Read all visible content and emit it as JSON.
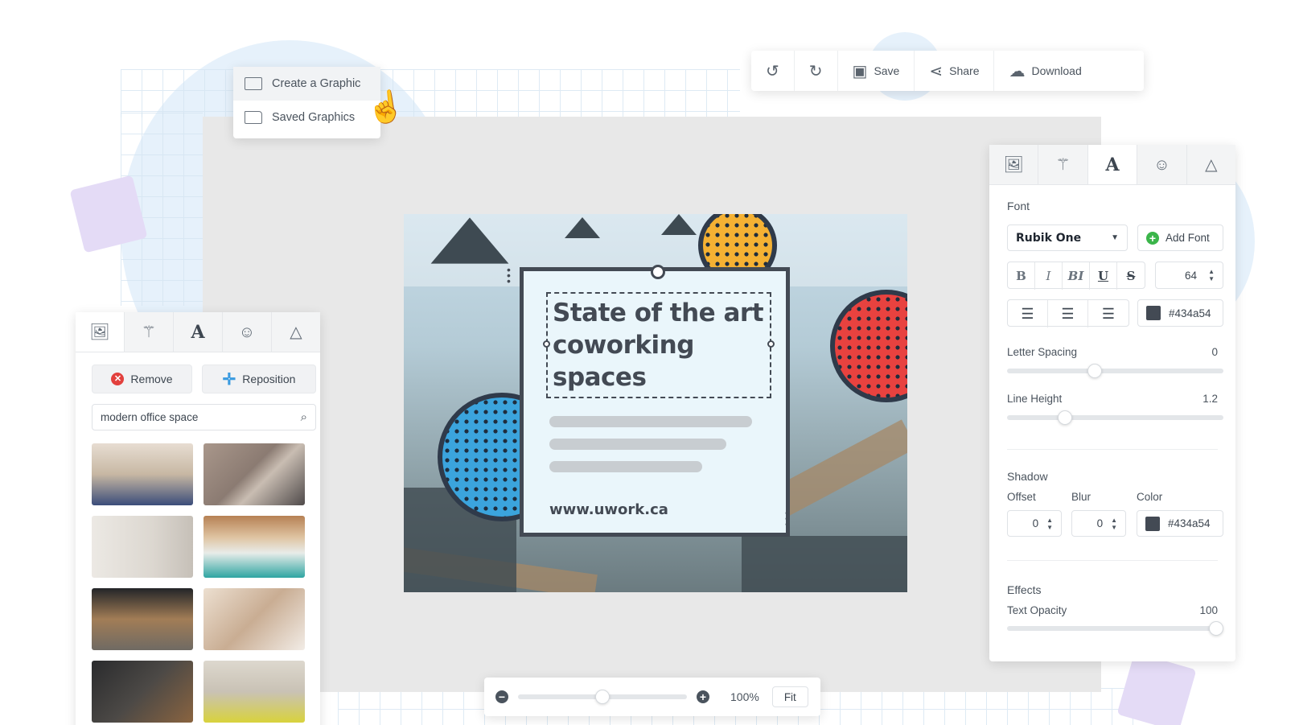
{
  "menu": {
    "items": [
      {
        "label": "Create a Graphic",
        "icon": "image-icon"
      },
      {
        "label": "Saved Graphics",
        "icon": "folder-icon"
      }
    ]
  },
  "toolbar": {
    "undo_icon": "undo-icon",
    "redo_icon": "redo-icon",
    "save_label": "Save",
    "share_label": "Share",
    "download_label": "Download"
  },
  "canvas": {
    "headline": "State of the art coworking spaces",
    "url": "www.uwork.ca"
  },
  "left_panel": {
    "tabs": [
      "image-icon",
      "magic-wand-icon",
      "text-icon",
      "emoji-icon",
      "shape-icon"
    ],
    "active_tab": 0,
    "remove_label": "Remove",
    "reposition_label": "Reposition",
    "search_value": "modern office space",
    "images": [
      "dining-room",
      "person-laptop",
      "vase-wall",
      "create-mural",
      "office-workers",
      "handshake",
      "coffee-laptop",
      "yellow-chair"
    ]
  },
  "right_panel": {
    "tabs": [
      "image-icon",
      "magic-wand-icon",
      "text-icon",
      "emoji-icon",
      "shape-icon"
    ],
    "active_tab": 2,
    "font_label": "Font",
    "font_value": "Rubik One",
    "add_font_label": "Add Font",
    "format_buttons": [
      "B",
      "I",
      "BI",
      "U",
      "S"
    ],
    "font_size": "64",
    "text_color": "#434a54",
    "letter_spacing_label": "Letter Spacing",
    "letter_spacing_value": "0",
    "letter_spacing_level": 0.4,
    "line_height_label": "Line Height",
    "line_height_value": "1.2",
    "line_height_level": 0.25,
    "shadow_label": "Shadow",
    "offset_label": "Offset",
    "offset_value": "0",
    "blur_label": "Blur",
    "blur_value": "0",
    "color_label": "Color",
    "shadow_color": "#434a54",
    "effects_label": "Effects",
    "text_opacity_label": "Text Opacity",
    "text_opacity_value": "100",
    "text_opacity_level": 1.0
  },
  "zoom": {
    "value": "100%",
    "fit_label": "Fit",
    "level": 0.5
  }
}
